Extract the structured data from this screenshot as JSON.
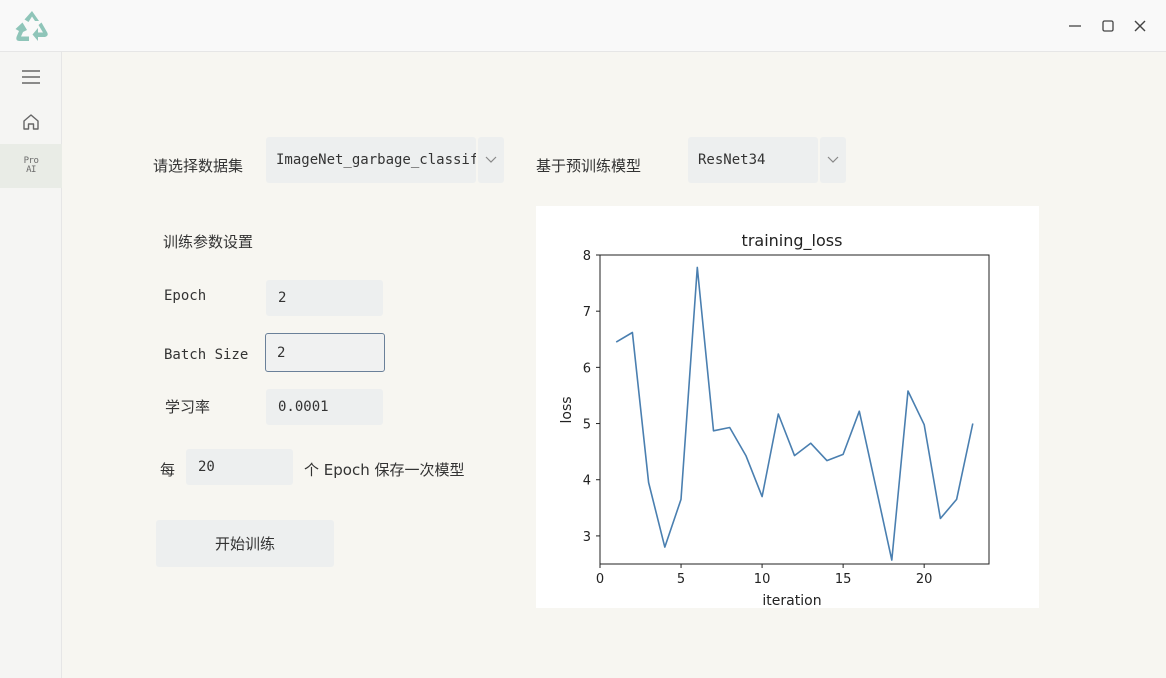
{
  "window": {
    "logo_icon": "recycle-icon",
    "controls": [
      "minimize-icon",
      "maximize-icon",
      "close-icon"
    ]
  },
  "sidebar": {
    "items": [
      {
        "name": "menu",
        "icon": "hamburger-icon"
      },
      {
        "name": "home",
        "icon": "home-icon"
      },
      {
        "name": "pro-ai",
        "line1": "Pro",
        "line2": "AI",
        "active": true
      }
    ]
  },
  "dataset": {
    "label": "请选择数据集",
    "value": "ImageNet_garbage_classif:"
  },
  "model": {
    "label": "基于预训练模型",
    "value": "ResNet34"
  },
  "params": {
    "title": "训练参数设置",
    "epoch_label": "Epoch",
    "epoch_value": "2",
    "batch_label": "Batch Size",
    "batch_value": "2",
    "lr_label": "学习率",
    "lr_value": "0.0001"
  },
  "save": {
    "prefix": "每",
    "value": "20",
    "suffix": "个 Epoch 保存一次模型"
  },
  "train_button": "开始训练",
  "colors": {
    "accent": "#6a8099",
    "line": "#4a7fb0",
    "logo": "#8fc5b9"
  },
  "chart_data": {
    "type": "line",
    "title": "training_loss",
    "xlabel": "iteration",
    "ylabel": "loss",
    "xlim": [
      0,
      24
    ],
    "ylim": [
      2.5,
      8.0
    ],
    "xticks": [
      0,
      5,
      10,
      15,
      20
    ],
    "yticks": [
      3,
      4,
      5,
      6,
      7,
      8
    ],
    "x": [
      1,
      2,
      3,
      4,
      5,
      6,
      7,
      8,
      9,
      10,
      11,
      12,
      13,
      14,
      15,
      16,
      17,
      18,
      19,
      20,
      21,
      22,
      23
    ],
    "y": [
      6.45,
      6.62,
      3.95,
      2.8,
      3.65,
      7.78,
      4.87,
      4.93,
      4.43,
      3.7,
      5.17,
      4.43,
      4.65,
      4.34,
      4.45,
      5.22,
      3.9,
      2.57,
      5.58,
      4.98,
      3.31,
      3.65,
      5.0
    ],
    "grid": false,
    "legend": "none"
  }
}
